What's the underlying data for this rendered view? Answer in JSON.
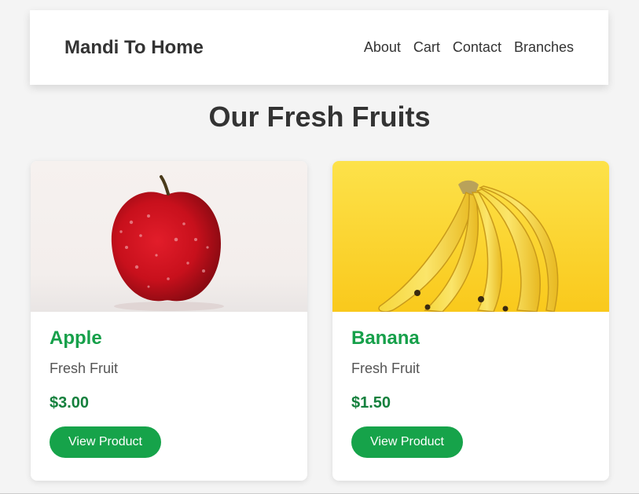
{
  "header": {
    "brand": "Mandi To Home",
    "nav": [
      "About",
      "Cart",
      "Contact",
      "Branches"
    ]
  },
  "main": {
    "title": "Our Fresh Fruits",
    "products": [
      {
        "name": "Apple",
        "description": "Fresh Fruit",
        "price": "$3.00",
        "button": "View Product",
        "image": "apple-image"
      },
      {
        "name": "Banana",
        "description": "Fresh Fruit",
        "price": "$1.50",
        "button": "View Product",
        "image": "banana-image"
      }
    ]
  },
  "colors": {
    "accent": "#16a34a",
    "price": "#15803d",
    "background": "#f4f4f4"
  }
}
